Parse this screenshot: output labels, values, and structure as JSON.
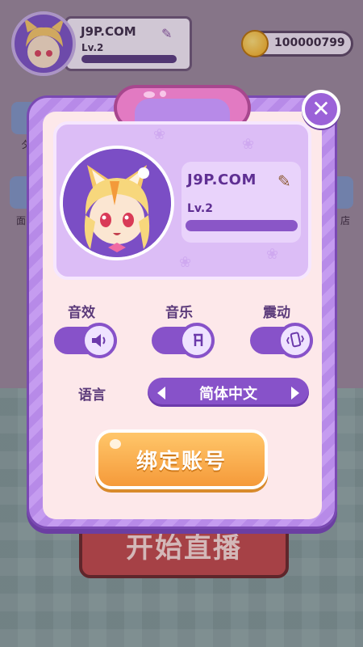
{
  "header": {
    "username": "J9P.COM",
    "level": "Lv.2"
  },
  "coins": {
    "value": "100000799",
    "icon": "coin-icon"
  },
  "side_buttons": {
    "left_top": "夕",
    "left_mid": "面",
    "right_mid": "店"
  },
  "start_button": {
    "label": "开始直播"
  },
  "modal": {
    "close_icon": "close-icon",
    "profile": {
      "username": "J9P.COM",
      "level": "Lv.2",
      "level_progress": 0.0,
      "edit_icon": "pencil-icon"
    },
    "settings": {
      "sound_effects_label": "音效",
      "music_label": "音乐",
      "vibration_label": "震动",
      "sound_icon": "speaker-icon",
      "music_icon": "music-note-icon",
      "vibration_icon": "vibrate-icon",
      "sound_on": true,
      "music_on": true,
      "vibration_on": true
    },
    "language": {
      "label": "语言",
      "value": "简体中文"
    },
    "bind_button": {
      "label": "绑定账号"
    }
  },
  "colors": {
    "modal_purple": "#b78ae8",
    "toggle_purple": "#8752c9",
    "bind_orange": "#f59a3a",
    "handle_pink": "#e27ac2"
  }
}
